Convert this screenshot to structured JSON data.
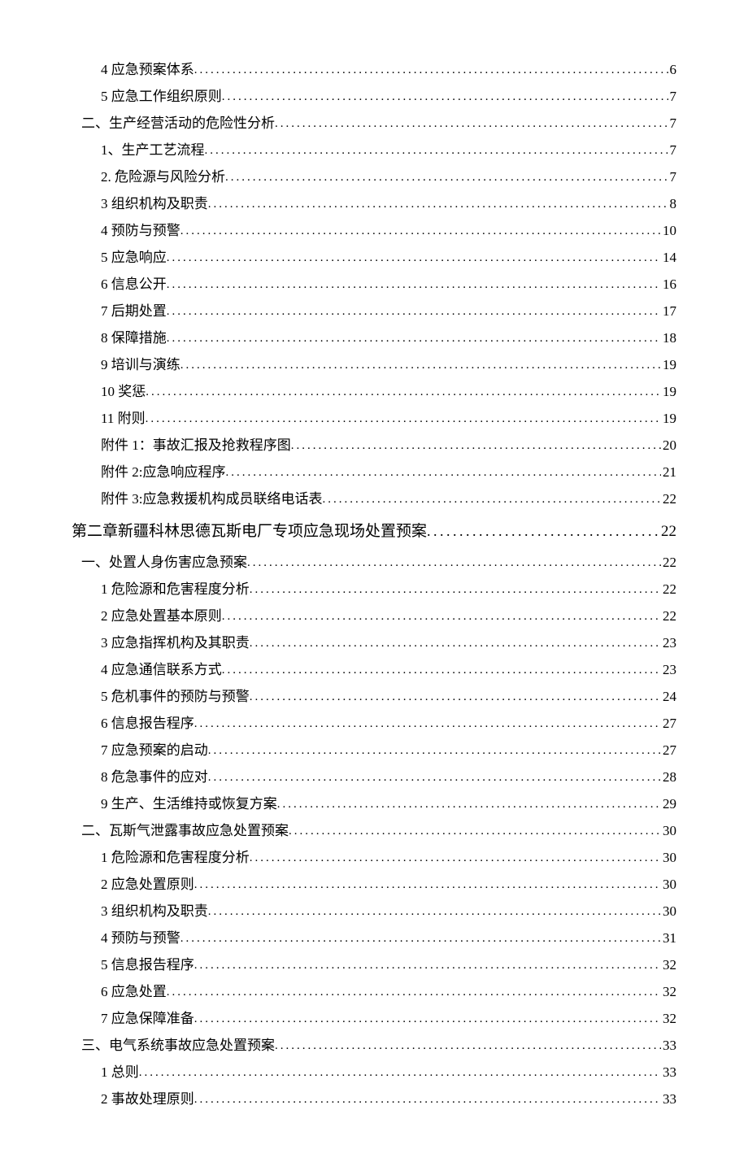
{
  "toc": [
    {
      "level": 2,
      "title": "4 应急预案体系",
      "page": "6"
    },
    {
      "level": 2,
      "title": "5 应急工作组织原则",
      "page": "7"
    },
    {
      "level": 1,
      "title": "二、生产经营活动的危险性分析 ",
      "page": "7"
    },
    {
      "level": 2,
      "title": "1、生产工艺流程 ",
      "page": "7"
    },
    {
      "level": 2,
      "title": "2. 危险源与风险分析 ",
      "page": "7"
    },
    {
      "level": 2,
      "title": "3 组织机构及职责",
      "page": "8"
    },
    {
      "level": 2,
      "title": "4 预防与预警",
      "page": "10"
    },
    {
      "level": 2,
      "title": "5 应急响应",
      "page": "14"
    },
    {
      "level": 2,
      "title": "6 信息公开",
      "page": "16"
    },
    {
      "level": 2,
      "title": "7 后期处置",
      "page": "17"
    },
    {
      "level": 2,
      "title": "8 保障措施",
      "page": "18"
    },
    {
      "level": 2,
      "title": "9 培训与演练",
      "page": "19"
    },
    {
      "level": 2,
      "title": "10 奖惩",
      "page": "19"
    },
    {
      "level": 2,
      "title": "11 附则",
      "page": "19"
    },
    {
      "level": 2,
      "title": "附件 1：事故汇报及抢救程序图",
      "page": "20"
    },
    {
      "level": 2,
      "title": "附件 2:应急响应程序",
      "page": "21"
    },
    {
      "level": 2,
      "title": "附件 3:应急救援机构成员联络电话表",
      "page": "22"
    },
    {
      "level": 0,
      "title": "第二章新疆科林思德瓦斯电厂专项应急现场处置预案",
      "page": "22"
    },
    {
      "level": 1,
      "title": "一、处置人身伤害应急预案 ",
      "page": "22"
    },
    {
      "level": 2,
      "title": "1 危险源和危害程度分析",
      "page": "22"
    },
    {
      "level": 2,
      "title": "2 应急处置基本原则",
      "page": "22"
    },
    {
      "level": 2,
      "title": "3 应急指挥机构及其职责",
      "page": "23"
    },
    {
      "level": 2,
      "title": "4 应急通信联系方式",
      "page": "23"
    },
    {
      "level": 2,
      "title": "5 危机事件的预防与预警",
      "page": "24"
    },
    {
      "level": 2,
      "title": "6 信息报告程序",
      "page": "27"
    },
    {
      "level": 2,
      "title": "7 应急预案的启动",
      "page": "27"
    },
    {
      "level": 2,
      "title": "8 危急事件的应对",
      "page": "28"
    },
    {
      "level": 2,
      "title": "9 生产、生活维持或恢复方案",
      "page": "29"
    },
    {
      "level": 1,
      "title": "二、瓦斯气泄露事故应急处置预案 ",
      "page": "30"
    },
    {
      "level": 2,
      "title": "1 危险源和危害程度分析",
      "page": "30"
    },
    {
      "level": 2,
      "title": "2 应急处置原则",
      "page": "30"
    },
    {
      "level": 2,
      "title": "3 组织机构及职责",
      "page": "30"
    },
    {
      "level": 2,
      "title": "4 预防与预警",
      "page": "31"
    },
    {
      "level": 2,
      "title": "5 信息报告程序",
      "page": "32"
    },
    {
      "level": 2,
      "title": "6 应急处置",
      "page": "32"
    },
    {
      "level": 2,
      "title": "7 应急保障准备",
      "page": "32"
    },
    {
      "level": 1,
      "title": "三、电气系统事故应急处置预案 ",
      "page": "33"
    },
    {
      "level": 2,
      "title": "1 总则",
      "page": "33"
    },
    {
      "level": 2,
      "title": "2 事故处理原则",
      "page": "33"
    }
  ]
}
